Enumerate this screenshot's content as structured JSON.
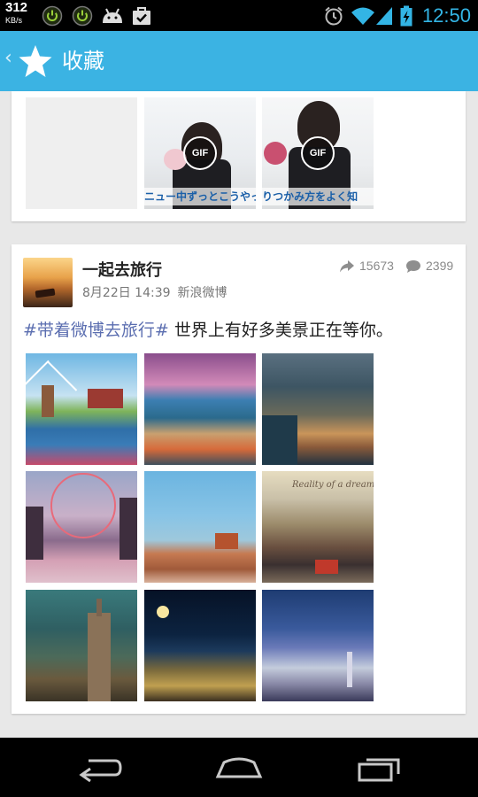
{
  "status_bar": {
    "net_speed": "312",
    "net_speed_unit": "KB/s",
    "time": "12:50",
    "icons": [
      "power-icon",
      "power-icon",
      "android-icon",
      "briefcase-check-icon",
      "alarm-icon",
      "wifi-icon",
      "signal-icon",
      "battery-charging-icon"
    ]
  },
  "action_bar": {
    "title": "收藏",
    "back_icon": "chevron-left-icon",
    "app_icon": "star-icon"
  },
  "previous_card": {
    "gif_badge": "GIF",
    "subtitles": [
      "ニュー中ずっとこうやって",
      "りつかみ方をよく知"
    ]
  },
  "post": {
    "username": "一起去旅行",
    "date": "8月22日 14:39",
    "source": "新浪微博",
    "reposts": "15673",
    "comments": "2399",
    "hashtag": "#带着微博去旅行#",
    "text": " 世界上有好多美景正在等你。",
    "image_overlay_text": "Reality of a dream"
  },
  "nav_bar": {
    "buttons": [
      "back-icon",
      "home-icon",
      "recent-apps-icon"
    ]
  },
  "colors": {
    "accent": "#3bb3e3",
    "hashtag": "#5b6eb0",
    "clock": "#33b5e5"
  }
}
